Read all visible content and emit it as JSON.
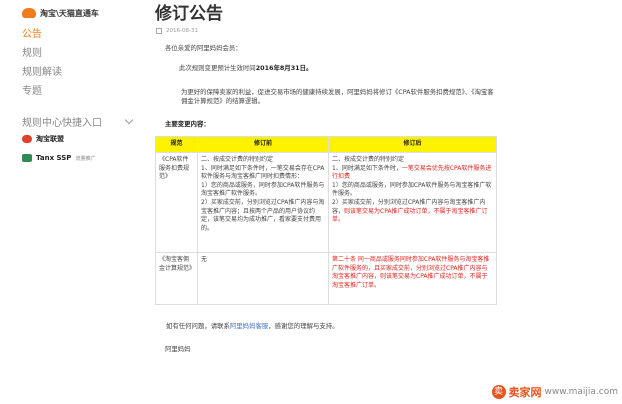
{
  "sidebar": {
    "brand": "淘宝\\天猫直通车",
    "items": [
      {
        "label": "公告",
        "active": true
      },
      {
        "label": "规则",
        "active": false
      },
      {
        "label": "规则解读",
        "active": false
      },
      {
        "label": "专题",
        "active": false
      }
    ],
    "section_label": "规则中心快捷入口",
    "partners": [
      {
        "label": "淘宝联盟",
        "sub": ""
      },
      {
        "label": "Tanx SSP",
        "sub": "流量推广"
      }
    ]
  },
  "article": {
    "title": "修订公告",
    "date": "2016-08-31",
    "greeting": "各位亲爱的阿里妈妈会员：",
    "effective_prefix": "此次规则变更预计生效时间",
    "effective_date": "2016年8月31日。",
    "purpose": "为更好的保障卖家的利益，促进交易市场的健康持续发展，阿里妈妈将修订《CPA软件服务扣费规范》、《淘宝客佣金计算规范》的结算逻辑。",
    "section_title": "主要变更内容：",
    "table": {
      "headers": [
        "规范",
        "修订前",
        "修订后"
      ],
      "rows": [
        {
          "name": "《CPA软件服务扣费规范》",
          "before": "二、按成交计费的特别约定\n1、同时满足如下条件时，一笔交易会存在CPA软件服务与淘宝客推广同时扣费情形：\n1）您的商品或服务，同时参加CPA软件服务与淘宝客推广软件服务。\n2）买家成交前，分别浏览过CPA推广内容与淘宝客推广内容；且按两个产品的用户协议约定，该笔交易均为成功推广，看家要支付费用的。",
          "after_plain_1": "二、按成交计费的特别约定\n1、同时满足如下条件时，",
          "after_red_1": "一笔交易会优先按CPA软件服务进行扣费",
          "after_plain_2": "\n1）您的商品或服务，同时参加CPA软件服务与淘宝客推广软件服务。\n2）买家成交前，分别浏览过CPA推广内容与淘宝客推广内容，",
          "after_red_2": "则该笔交易为CPA推广成功订单，不属于淘宝客推广订单。"
        },
        {
          "name": "《淘宝客佣金计算规范》",
          "before": "无",
          "after_red": "第二十条 同一商品或服务同时参加CPA软件服务与淘宝客推广软件服务的，且买家成交前，分别浏览过CPA推广内容与淘宝客推广内容，则该笔交易为CPA推广成功订单，不属于淘宝客推广订单。"
        }
      ]
    },
    "footer_prefix": "如有任何问题，请联系",
    "footer_link": "阿里妈妈客服",
    "footer_suffix": "，感谢您的理解与支持。",
    "signature": "阿里妈妈"
  },
  "watermark": {
    "icon_glyph": "卖",
    "name": "卖家网",
    "url": "www.maijia.com"
  },
  "colors": {
    "accent": "#f27b1e",
    "highlight": "#fff200",
    "red": "#e0241b",
    "link": "#3b73c9"
  }
}
